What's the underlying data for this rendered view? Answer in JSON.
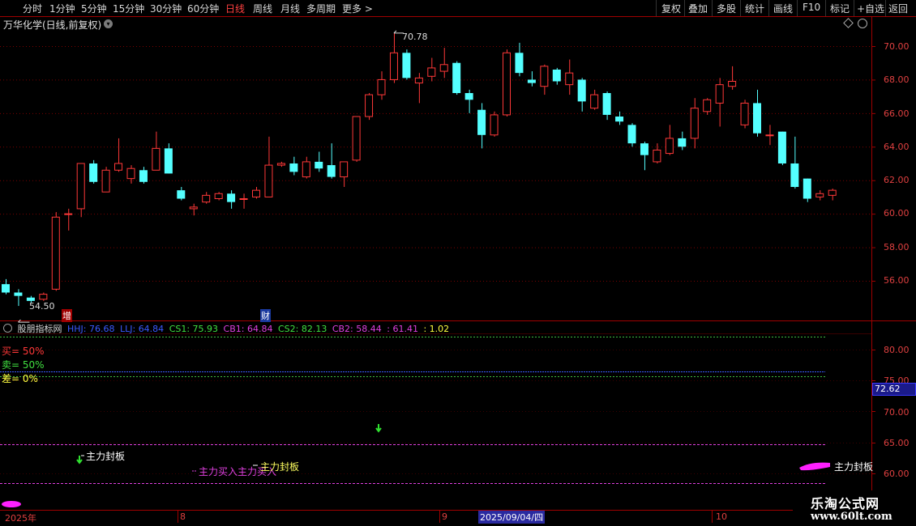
{
  "toolbar": {
    "periods": [
      "分时",
      "1分钟",
      "5分钟",
      "15分钟",
      "30分钟",
      "60分钟",
      "日线",
      "周线",
      "月线",
      "多周期",
      "更多 >"
    ],
    "active_period": "日线",
    "right_buttons": [
      "复权",
      "叠加",
      "多股",
      "统计",
      "画线",
      "F10",
      "标记",
      "+自选",
      "返回"
    ]
  },
  "main": {
    "title": "万华化学(日线,前复权)",
    "high_label": "70.78",
    "low_label": "54.50",
    "event_marks": [
      "增",
      "财"
    ],
    "y_ticks": [
      "70.00",
      "68.00",
      "66.00",
      "64.00",
      "62.00",
      "60.00",
      "58.00",
      "56.00"
    ]
  },
  "indicator": {
    "name": "股朋指标网",
    "params": [
      {
        "text": "HHJ: 76.68",
        "color": "#3a5aff"
      },
      {
        "text": "LLJ: 64.84",
        "color": "#3a5aff"
      },
      {
        "text": "CS1: 75.93",
        "color": "#40e040"
      },
      {
        "text": "CB1: 64.84",
        "color": "#e040e0"
      },
      {
        "text": "CS2: 82.13",
        "color": "#40e040"
      },
      {
        "text": "CB2: 58.44",
        "color": "#e040e0"
      },
      {
        "text": ": 61.41",
        "color": "#e040e0"
      },
      {
        "text": ": 1.02",
        "color": "#ffff40"
      }
    ],
    "buy": "买= 50%",
    "sell": "卖= 50%",
    "diff": "差= 0%",
    "y_ticks": [
      "80.00",
      "75.00",
      "70.00",
      "65.00",
      "60.00"
    ],
    "current_value": "72.62",
    "signals": {
      "seal1": "主力封板",
      "buy_in": "主力买入主力买入",
      "seal2": "主力封板",
      "seal3": "主力封板"
    }
  },
  "date_axis": {
    "labels": [
      "2025年",
      "8",
      "9",
      "2025/09/04/四",
      "10"
    ]
  },
  "watermark": {
    "line1": "乐淘公式网",
    "line2": "www.60lt.com"
  },
  "chart_data": {
    "type": "candlestick",
    "y_range": [
      54.5,
      71.0
    ],
    "y_ticks": [
      70,
      68,
      66,
      64,
      62,
      60,
      58,
      56
    ],
    "candles": [
      {
        "o": 55.8,
        "c": 55.3,
        "h": 56.1,
        "l": 55.2
      },
      {
        "o": 55.3,
        "c": 55.1,
        "h": 55.5,
        "l": 54.5
      },
      {
        "o": 55.0,
        "c": 54.8,
        "h": 55.1,
        "l": 54.7
      },
      {
        "o": 54.9,
        "c": 55.2,
        "h": 55.3,
        "l": 54.8
      },
      {
        "o": 55.5,
        "c": 59.8,
        "h": 60.1,
        "l": 55.4
      },
      {
        "o": 60.0,
        "c": 60.0,
        "h": 60.3,
        "l": 59.0
      },
      {
        "o": 60.3,
        "c": 63.0,
        "h": 63.0,
        "l": 59.8
      },
      {
        "o": 63.0,
        "c": 61.9,
        "h": 63.2,
        "l": 61.8
      },
      {
        "o": 61.3,
        "c": 62.6,
        "h": 62.8,
        "l": 61.3
      },
      {
        "o": 62.6,
        "c": 63.0,
        "h": 64.5,
        "l": 62.5
      },
      {
        "o": 62.1,
        "c": 62.7,
        "h": 62.9,
        "l": 61.8
      },
      {
        "o": 62.6,
        "c": 61.9,
        "h": 62.8,
        "l": 61.8
      },
      {
        "o": 62.6,
        "c": 63.9,
        "h": 64.9,
        "l": 62.6
      },
      {
        "o": 63.9,
        "c": 62.4,
        "h": 64.2,
        "l": 62.4
      },
      {
        "o": 61.4,
        "c": 60.9,
        "h": 61.6,
        "l": 60.8
      },
      {
        "o": 60.3,
        "c": 60.4,
        "h": 60.6,
        "l": 59.9
      },
      {
        "o": 60.7,
        "c": 61.1,
        "h": 61.3,
        "l": 60.6
      },
      {
        "o": 60.9,
        "c": 61.2,
        "h": 61.3,
        "l": 60.8
      },
      {
        "o": 61.2,
        "c": 60.7,
        "h": 61.4,
        "l": 60.3
      },
      {
        "o": 60.9,
        "c": 60.9,
        "h": 61.2,
        "l": 60.3
      },
      {
        "o": 61.0,
        "c": 61.4,
        "h": 61.6,
        "l": 60.9
      },
      {
        "o": 61.0,
        "c": 62.9,
        "h": 64.6,
        "l": 61.0
      },
      {
        "o": 62.9,
        "c": 63.0,
        "h": 63.1,
        "l": 62.8
      },
      {
        "o": 63.0,
        "c": 62.5,
        "h": 63.4,
        "l": 62.3
      },
      {
        "o": 62.2,
        "c": 63.1,
        "h": 63.4,
        "l": 62.1
      },
      {
        "o": 63.1,
        "c": 62.7,
        "h": 63.7,
        "l": 62.5
      },
      {
        "o": 62.9,
        "c": 62.2,
        "h": 64.2,
        "l": 62.1
      },
      {
        "o": 62.2,
        "c": 63.1,
        "h": 63.1,
        "l": 61.6
      },
      {
        "o": 63.2,
        "c": 65.8,
        "h": 65.8,
        "l": 63.1
      },
      {
        "o": 65.8,
        "c": 67.1,
        "h": 67.2,
        "l": 65.6
      },
      {
        "o": 67.1,
        "c": 68.0,
        "h": 68.5,
        "l": 66.8
      },
      {
        "o": 68.0,
        "c": 69.6,
        "h": 70.78,
        "l": 67.8
      },
      {
        "o": 69.6,
        "c": 68.1,
        "h": 69.8,
        "l": 68.0
      },
      {
        "o": 67.8,
        "c": 68.1,
        "h": 68.4,
        "l": 66.6
      },
      {
        "o": 68.2,
        "c": 68.7,
        "h": 69.3,
        "l": 67.9
      },
      {
        "o": 68.5,
        "c": 68.9,
        "h": 69.9,
        "l": 68.1
      },
      {
        "o": 69.0,
        "c": 67.2,
        "h": 69.1,
        "l": 67.1
      },
      {
        "o": 67.2,
        "c": 66.8,
        "h": 67.4,
        "l": 66.0
      },
      {
        "o": 66.2,
        "c": 64.7,
        "h": 66.6,
        "l": 63.9
      },
      {
        "o": 64.7,
        "c": 65.9,
        "h": 66.1,
        "l": 64.6
      },
      {
        "o": 65.9,
        "c": 69.6,
        "h": 69.8,
        "l": 65.8
      },
      {
        "o": 69.6,
        "c": 68.4,
        "h": 70.2,
        "l": 68.2
      },
      {
        "o": 68.0,
        "c": 67.8,
        "h": 68.5,
        "l": 67.6
      },
      {
        "o": 67.6,
        "c": 68.8,
        "h": 68.9,
        "l": 67.1
      },
      {
        "o": 68.6,
        "c": 67.9,
        "h": 68.7,
        "l": 67.7
      },
      {
        "o": 67.7,
        "c": 68.4,
        "h": 69.2,
        "l": 67.1
      },
      {
        "o": 68.0,
        "c": 66.7,
        "h": 68.1,
        "l": 66.1
      },
      {
        "o": 66.3,
        "c": 67.1,
        "h": 67.4,
        "l": 66.2
      },
      {
        "o": 67.2,
        "c": 65.9,
        "h": 67.3,
        "l": 65.6
      },
      {
        "o": 65.8,
        "c": 65.5,
        "h": 66.1,
        "l": 65.3
      },
      {
        "o": 65.3,
        "c": 64.2,
        "h": 65.4,
        "l": 64.0
      },
      {
        "o": 64.2,
        "c": 63.5,
        "h": 64.3,
        "l": 62.6
      },
      {
        "o": 63.1,
        "c": 63.8,
        "h": 64.2,
        "l": 63.0
      },
      {
        "o": 63.6,
        "c": 64.5,
        "h": 65.3,
        "l": 63.5
      },
      {
        "o": 64.5,
        "c": 64.0,
        "h": 64.9,
        "l": 63.8
      },
      {
        "o": 64.5,
        "c": 66.3,
        "h": 66.9,
        "l": 63.9
      },
      {
        "o": 66.1,
        "c": 66.8,
        "h": 66.9,
        "l": 65.9
      },
      {
        "o": 66.6,
        "c": 67.7,
        "h": 68.1,
        "l": 65.2
      },
      {
        "o": 67.6,
        "c": 67.9,
        "h": 68.8,
        "l": 67.4
      },
      {
        "o": 65.3,
        "c": 66.6,
        "h": 66.8,
        "l": 65.1
      },
      {
        "o": 66.6,
        "c": 64.8,
        "h": 67.4,
        "l": 64.6
      },
      {
        "o": 64.7,
        "c": 64.7,
        "h": 65.3,
        "l": 64.1
      },
      {
        "o": 64.9,
        "c": 63.0,
        "h": 64.9,
        "l": 62.9
      },
      {
        "o": 63.0,
        "c": 61.6,
        "h": 64.6,
        "l": 61.5
      },
      {
        "o": 62.1,
        "c": 60.9,
        "h": 62.1,
        "l": 60.7
      },
      {
        "o": 61.0,
        "c": 61.2,
        "h": 61.4,
        "l": 60.8
      },
      {
        "o": 61.1,
        "c": 61.4,
        "h": 61.5,
        "l": 60.8
      }
    ]
  },
  "colors": {
    "up": "#ff3838",
    "down": "#54ffff",
    "grid": "#7a0000",
    "border": "#a00000"
  }
}
